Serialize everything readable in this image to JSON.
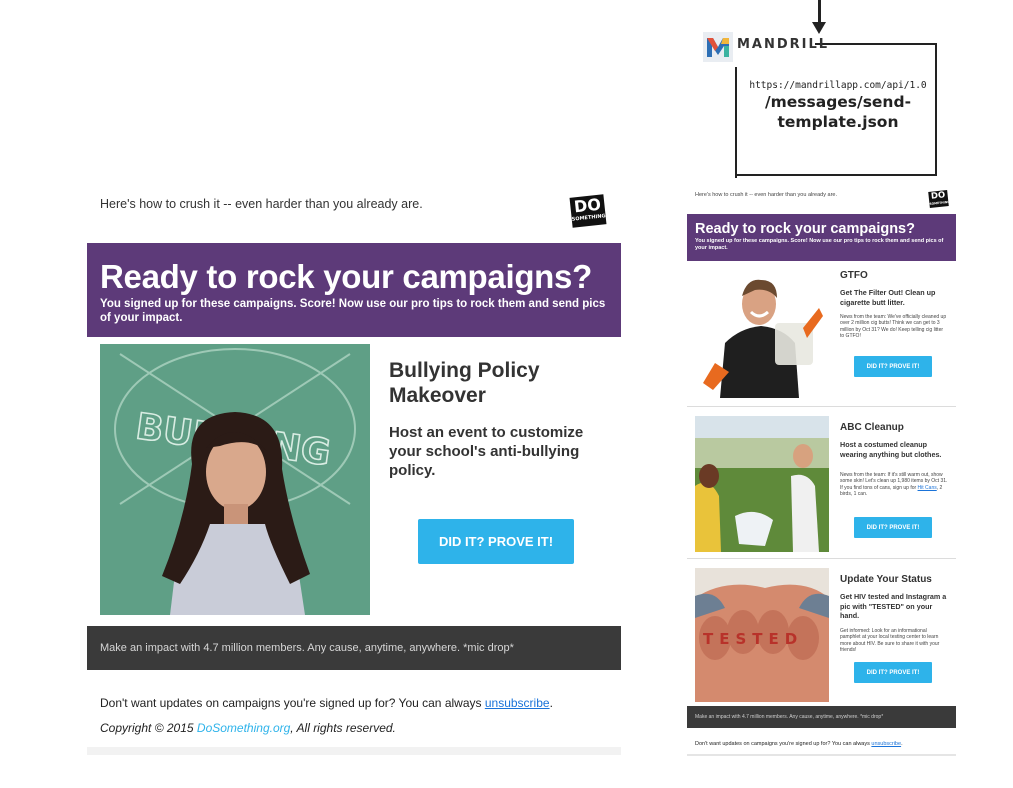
{
  "annotation": {
    "brand": "MANDRILL",
    "api_url": "https://mandrillapp.com/api/1.0",
    "api_path_line1": "/messages/send-",
    "api_path_line2": "template.json"
  },
  "desktop": {
    "preheader": "Here's how to crush it -- even harder than you already are.",
    "logo_big": "DO",
    "logo_small": "SOMETHING.ORG",
    "hero_title": "Ready to rock your campaigns?",
    "hero_sub": "You signed up for these campaigns. Score! Now use our pro tips to rock them and send pics of your impact.",
    "campaign": {
      "photo_text": "BULLYING",
      "title": "Bullying Policy Makeover",
      "subtitle": "Host an event to customize your school's anti-bullying policy.",
      "button": "DID IT? PROVE IT!"
    },
    "footer_bar": "Make an impact with 4.7 million members. Any cause, anytime, anywhere. *mic drop*",
    "unsub_text": "Don't want updates on campaigns you're signed up for? You can always ",
    "unsub_link": "unsubscribe",
    "unsub_end": ".",
    "copyright_pre": "Copyright © 2015 ",
    "copyright_link": "DoSomething.org",
    "copyright_post": ", All rights reserved."
  },
  "mobile": {
    "preheader": "Here's how to crush it -- even harder than you already are.",
    "logo_big": "DO",
    "logo_small": "SOMETHING.ORG",
    "hero_title": "Ready to rock your campaigns?",
    "hero_sub": "You signed up for these campaigns. Score! Now use our pro tips to rock them and send pics of your impact.",
    "cards": [
      {
        "title": "GTFO",
        "desc": "Get The Filter Out! Clean up cigarette butt litter.",
        "news": "News from the team: We've officially cleaned up over 2 million cig butts! Think we can get to 3 million by Oct 31? We do! Keep telling cig litter to GTFO!",
        "button": "DID IT? PROVE IT!"
      },
      {
        "title": "ABC Cleanup",
        "desc": "Host a costumed cleanup wearing anything but clothes.",
        "news_pre": "News from the team: If it's still warm out, show some skin! Let's clean up 1,980 items by Oct 31. If you find tons of cans, sign up for ",
        "news_link": "Hit Cans",
        "news_post": ", 2 birds, 1 can.",
        "button": "DID IT? PROVE IT!"
      },
      {
        "title": "Update Your Status",
        "desc": "Get HIV tested and Instagram a pic with \"TESTED\" on your hand.",
        "news": "Get informed: Look for an informational pamphlet at your local testing center to learn more about HIV. Be sure to share it with your friends!",
        "knuckles": "TESTED",
        "button": "DID IT? PROVE IT!"
      }
    ],
    "footer_bar": "Make an impact with 4.7 million members. Any cause, anytime, anywhere. *mic drop*",
    "unsub_text": "Don't want updates on campaigns you're signed up for? You can always ",
    "unsub_link": "unsubscribe",
    "unsub_end": "."
  }
}
